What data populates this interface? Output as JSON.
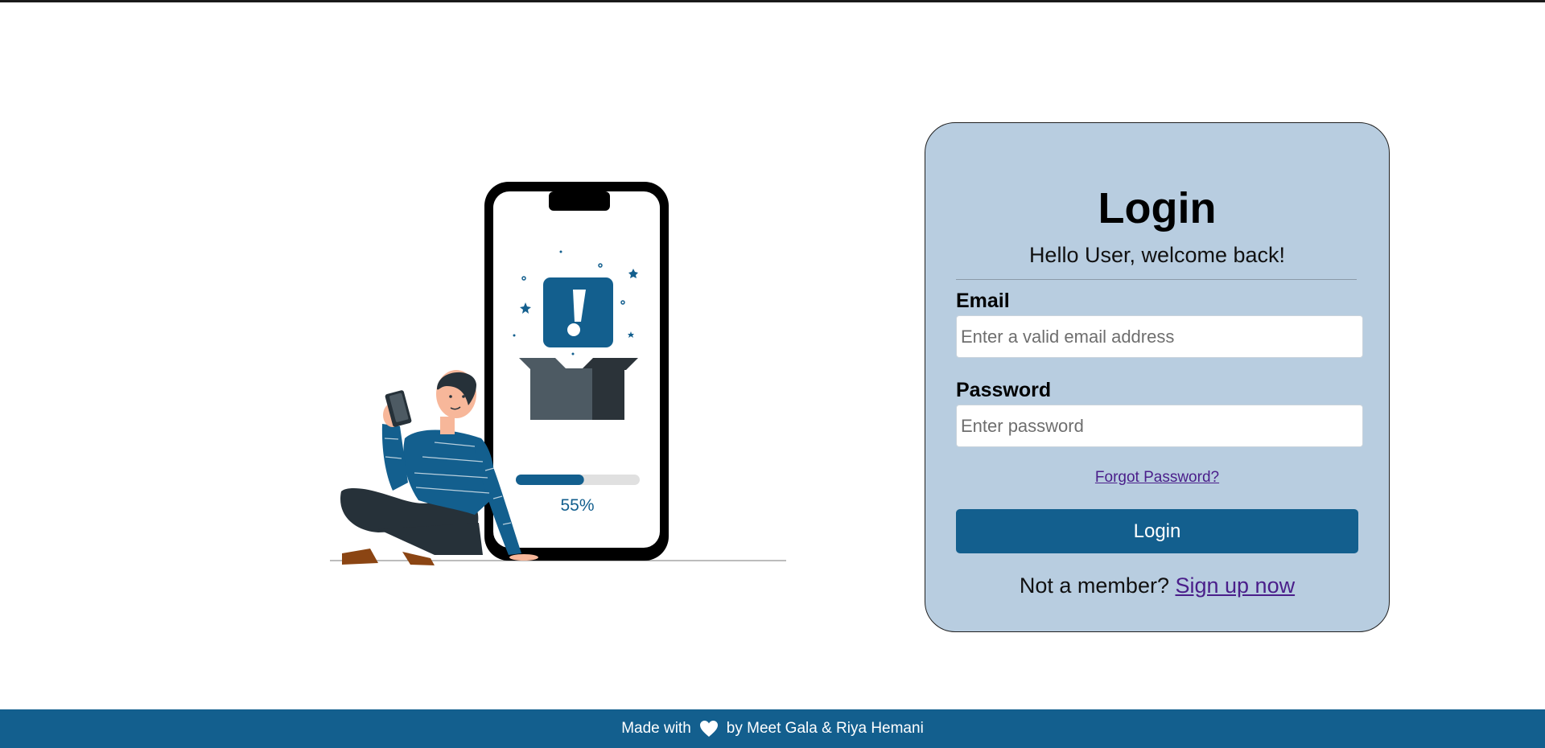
{
  "login_card": {
    "title": "Login",
    "subtitle": "Hello User, welcome back!",
    "email_label": "Email",
    "email_placeholder": "Enter a valid email address",
    "email_value": "",
    "password_label": "Password",
    "password_placeholder": "Enter password",
    "password_value": "",
    "forgot_link": "Forgot Password?",
    "login_button": "Login",
    "signup_prompt": "Not a member?",
    "signup_link": "Sign up now"
  },
  "illustration": {
    "progress_percent": 55,
    "progress_label": "55%"
  },
  "footer": {
    "made_with": "Made with",
    "heart_icon": "heart-icon",
    "credits": "by Meet Gala & Riya Hemani"
  },
  "colors": {
    "brand_blue": "#135f8e",
    "card_background": "#b8cde0",
    "link_purple": "#4a1e8a"
  }
}
